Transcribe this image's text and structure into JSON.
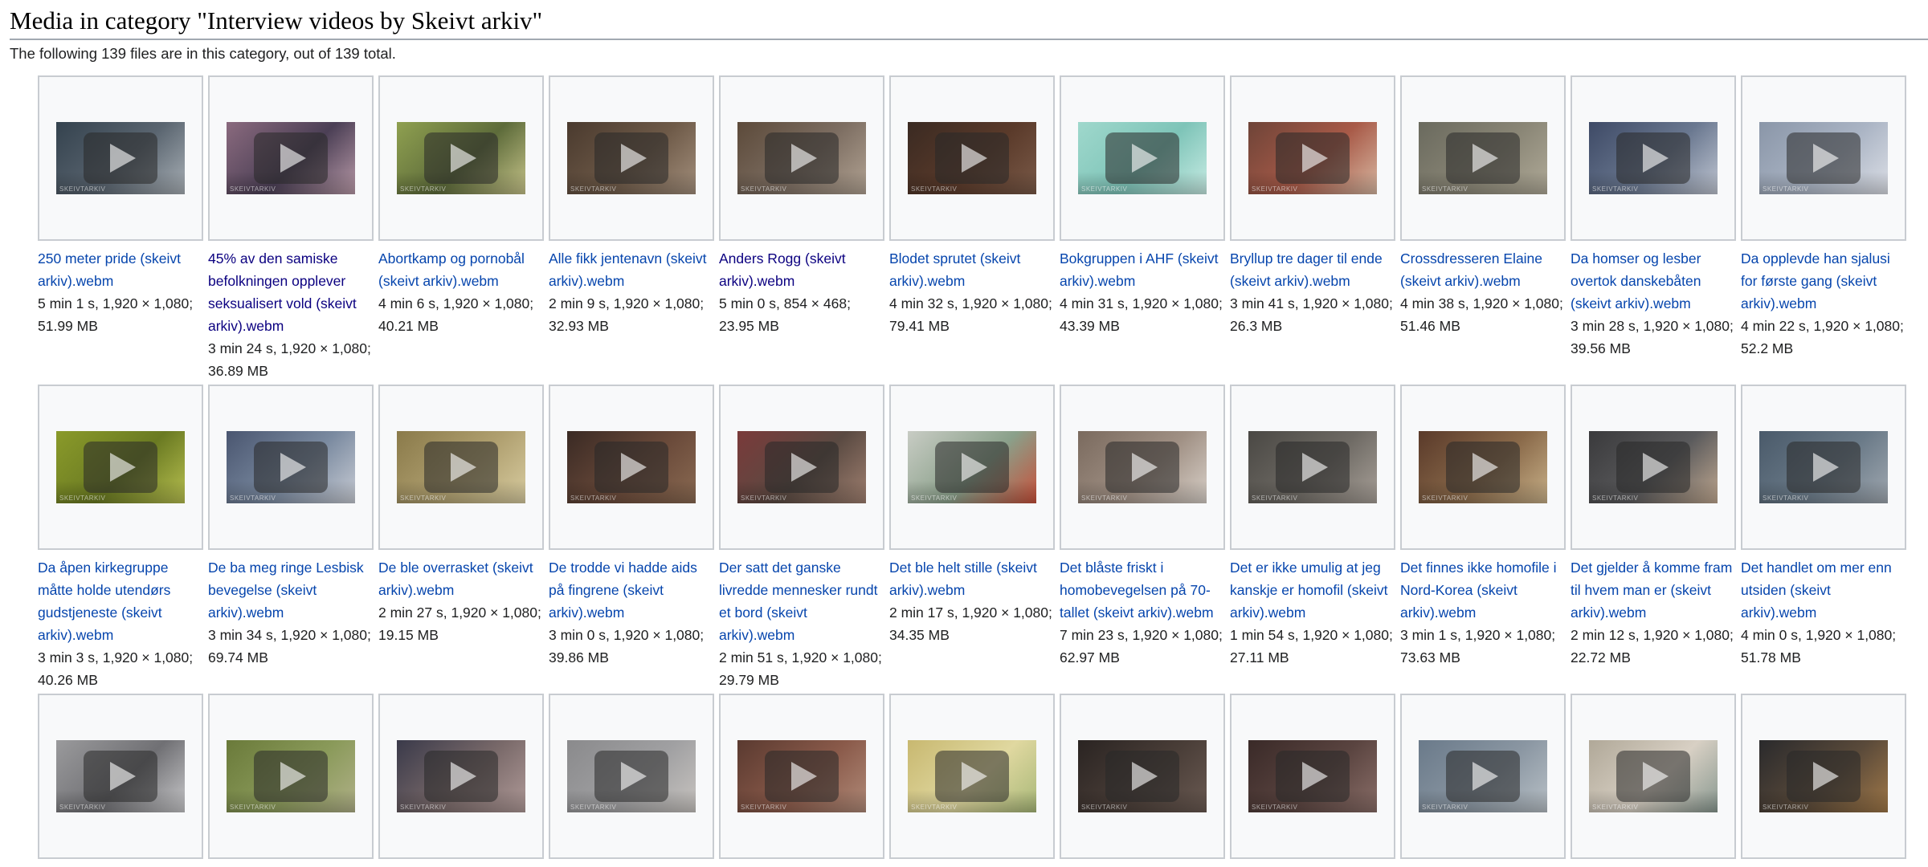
{
  "heading": "Media in category \"Interview videos by Skeivt arkiv\"",
  "intro": "The following 139 files are in this category, out of 139 total.",
  "watermark": "SKEIVTARKIV",
  "play_icon": "play-icon",
  "link_color": "#0645ad",
  "visited_link_color": "#0b0080",
  "rows": [
    [
      {
        "name": "250 meter pride (skeivt arkiv).webm",
        "meta": "5 min 1 s, 1,920 × 1,080; 51.99 MB",
        "colors": [
          "#34424e",
          "#5a6570",
          "#a9b0b6"
        ]
      },
      {
        "name": "45% av den samiske befolkningen opplever seksualisert vold (skeivt arkiv).webm",
        "meta": "3 min 24 s, 1,920 × 1,080; 36.89 MB",
        "visited": true,
        "colors": [
          "#8a6a7e",
          "#4b3f55",
          "#b99aa8"
        ]
      },
      {
        "name": "Abortkamp og pornobål (skeivt arkiv).webm",
        "meta": "4 min 6 s, 1,920 × 1,080; 40.21 MB",
        "colors": [
          "#8fa050",
          "#5d6b3a",
          "#c7c48a"
        ]
      },
      {
        "name": "Alle fikk jentenavn (skeivt arkiv).webm",
        "meta": "2 min 9 s, 1,920 × 1,080; 32.93 MB",
        "colors": [
          "#4a3a2e",
          "#6e5a48",
          "#a38f7c"
        ]
      },
      {
        "name": "Anders Rogg (skeivt arkiv).webm",
        "meta": "5 min 0 s, 854 × 468; 23.95 MB",
        "visited": true,
        "colors": [
          "#5c4a3a",
          "#7d6e62",
          "#b2a393"
        ]
      },
      {
        "name": "Blodet sprutet (skeivt arkiv).webm",
        "meta": "4 min 32 s, 1,920 × 1,080; 79.41 MB",
        "colors": [
          "#3a2a22",
          "#5a3a2a",
          "#7a5a48"
        ]
      },
      {
        "name": "Bokgruppen i AHF (skeivt arkiv).webm",
        "meta": "4 min 31 s, 1,920 × 1,080; 43.39 MB",
        "colors": [
          "#9fd8cc",
          "#7ec4b8",
          "#c8ece4"
        ]
      },
      {
        "name": "Bryllup tre dager til ende (skeivt arkiv).webm",
        "meta": "3 min 41 s, 1,920 × 1,080; 26.3 MB",
        "colors": [
          "#6e4438",
          "#a85a48",
          "#d8b8a2"
        ]
      },
      {
        "name": "Crossdresseren Elaine (skeivt arkiv).webm",
        "meta": "4 min 38 s, 1,920 × 1,080; 51.46 MB",
        "colors": [
          "#6a6a5e",
          "#8a8676",
          "#b0aa98"
        ]
      },
      {
        "name": "Da homser og lesber overtok danskebåten (skeivt arkiv).webm",
        "meta": "3 min 28 s, 1,920 × 1,080; 39.56 MB",
        "colors": [
          "#3e4a66",
          "#6a7890",
          "#c0c6d2"
        ]
      },
      {
        "name": "Da opplevde han sjalusi for første gang (skeivt arkiv).webm",
        "meta": "4 min 22 s, 1,920 × 1,080; 52.2 MB",
        "colors": [
          "#8a96a8",
          "#aab4c4",
          "#dcdfe6"
        ]
      }
    ],
    [
      {
        "name": "Da åpen kirkegruppe måtte holde utendørs gudstjeneste (skeivt arkiv).webm",
        "meta": "3 min 3 s, 1,920 × 1,080; 40.26 MB",
        "colors": [
          "#8a9a2a",
          "#6a7a22",
          "#b8c050"
        ]
      },
      {
        "name": "De ba meg ringe Lesbisk bevegelse (skeivt arkiv).webm",
        "meta": "3 min 34 s, 1,920 × 1,080; 69.74 MB",
        "colors": [
          "#4a5670",
          "#7a8aa0",
          "#c8ccd4"
        ]
      },
      {
        "name": "De ble overrasket (skeivt arkiv).webm",
        "meta": "2 min 27 s, 1,920 × 1,080; 19.15 MB",
        "colors": [
          "#8a7a4a",
          "#b0a070",
          "#d8cca0"
        ]
      },
      {
        "name": "De trodde vi hadde aids på fingrene (skeivt arkiv).webm",
        "meta": "3 min 0 s, 1,920 × 1,080; 39.86 MB",
        "colors": [
          "#3a2a24",
          "#6a4a3a",
          "#8a6a52"
        ]
      },
      {
        "name": "Der satt det ganske livredde mennesker rundt et bord (skeivt arkiv).webm",
        "meta": "2 min 51 s, 1,920 × 1,080; 29.79 MB",
        "colors": [
          "#7a3a3a",
          "#5a4a42",
          "#a08070"
        ]
      },
      {
        "name": "Det ble helt stille (skeivt arkiv).webm",
        "meta": "2 min 17 s, 1,920 × 1,080; 34.35 MB",
        "colors": [
          "#c8ccc4",
          "#8aa08a",
          "#c8503a"
        ]
      },
      {
        "name": "Det blåste friskt i homobevegelsen på 70-tallet (skeivt arkiv).webm",
        "meta": "7 min 23 s, 1,920 × 1,080; 62.97 MB",
        "colors": [
          "#7a6a5e",
          "#a09084",
          "#d8d0c8"
        ]
      },
      {
        "name": "Det er ikke umulig at jeg kanskje er homofil (skeivt arkiv).webm",
        "meta": "1 min 54 s, 1,920 × 1,080; 27.11 MB",
        "colors": [
          "#4a4844",
          "#6e6a64",
          "#a8a098"
        ]
      },
      {
        "name": "Det finnes ikke homofile i Nord-Korea (skeivt arkiv).webm",
        "meta": "3 min 1 s, 1,920 × 1,080; 73.63 MB",
        "colors": [
          "#5a3a2a",
          "#8a6a4a",
          "#c8b088"
        ]
      },
      {
        "name": "Det gjelder å komme fram til hvem man er (skeivt arkiv).webm",
        "meta": "2 min 12 s, 1,920 × 1,080; 22.72 MB",
        "colors": [
          "#3a3a3c",
          "#5a5a5c",
          "#c0a890"
        ]
      },
      {
        "name": "Det handlet om mer enn utsiden (skeivt arkiv).webm",
        "meta": "4 min 0 s, 1,920 × 1,080; 51.78 MB",
        "colors": [
          "#4a5a6a",
          "#6a7a88",
          "#a0a8b0"
        ]
      }
    ],
    [
      {
        "colors": [
          "#9a9a9c",
          "#707074",
          "#c8c8ca"
        ]
      },
      {
        "colors": [
          "#6a7a3a",
          "#8a9a5a",
          "#b0b088"
        ]
      },
      {
        "colors": [
          "#3a3a4a",
          "#7a6a6a",
          "#b09a98"
        ]
      },
      {
        "colors": [
          "#8a8a8c",
          "#a0a0a2",
          "#c8c4c0"
        ]
      },
      {
        "colors": [
          "#5a3a30",
          "#8a5a4a",
          "#b08a78"
        ]
      },
      {
        "colors": [
          "#c8b870",
          "#e0d8a0",
          "#a8b878"
        ]
      },
      {
        "colors": [
          "#2a2422",
          "#4a3e38",
          "#6a5a52"
        ]
      },
      {
        "colors": [
          "#3a2a28",
          "#5a4440",
          "#8a6e68"
        ]
      },
      {
        "colors": [
          "#6a7a8a",
          "#8a96a2",
          "#b8c0c6"
        ]
      },
      {
        "colors": [
          "#b0a898",
          "#d8d0c4",
          "#889890"
        ]
      },
      {
        "colors": [
          "#2a2a2c",
          "#5a4a3a",
          "#a07848"
        ]
      }
    ]
  ]
}
